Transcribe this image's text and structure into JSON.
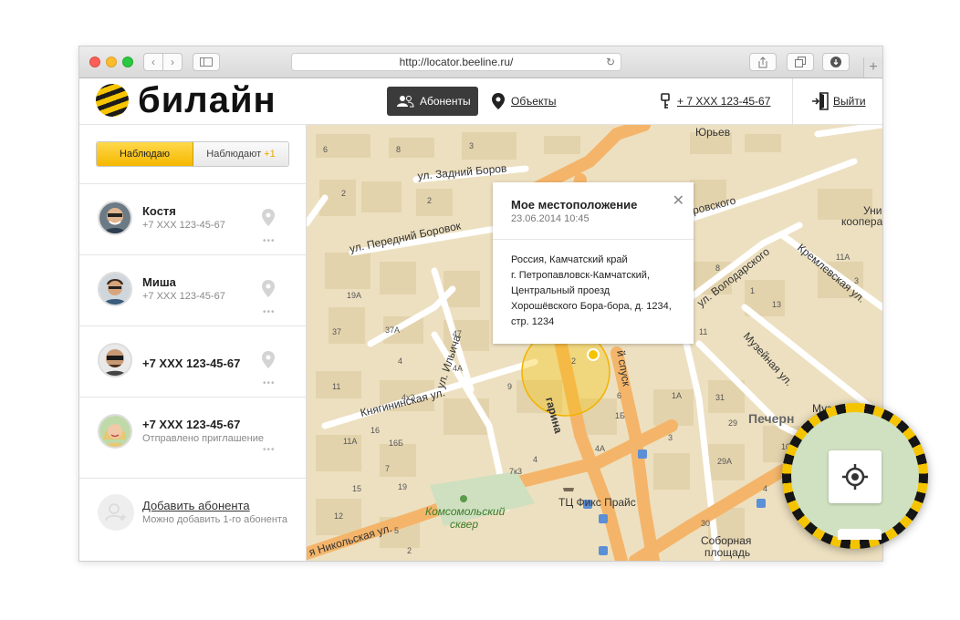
{
  "browser": {
    "url": "http://locator.beeline.ru/"
  },
  "header": {
    "logo_text": "билайн",
    "tab_subscribers": "Абоненты",
    "tab_objects": "Объекты",
    "phone": "+ 7 XXX 123-45-67",
    "logout": "Выйти"
  },
  "sidebar": {
    "toggle_watching": "Наблюдаю",
    "toggle_watched": "Наблюдают",
    "toggle_watched_count": "+1",
    "contacts": [
      {
        "name": "Костя",
        "phone": "+7 XXX 123-45-67"
      },
      {
        "name": "Миша",
        "phone": "+7 XXX 123-45-67"
      },
      {
        "name": "+7 XXX 123-45-67"
      },
      {
        "name": "+7 XXX 123-45-67",
        "status": "Отправлено приглашение"
      }
    ],
    "add_title": "Добавить абонента",
    "add_sub": "Можно добавить 1-го абонента"
  },
  "popup": {
    "title": "Мое местоположение",
    "time": "23.06.2014 10:45",
    "address": [
      "Россия, Камчатский край",
      "г. Петропавловск-Камчатский,",
      "Центральный проезд",
      "Хорошёвского Бора-бора, д. 1234,",
      "стр. 1234"
    ]
  },
  "map": {
    "streets": {
      "zadniy": "ул. Задний Боров",
      "peredniy": "ул. Передний Боровок",
      "ilyicha": "ул. Ильича",
      "knyaginin": "Княгининская ул.",
      "nikolskaya": "я Никольская ул.",
      "gagarina": "гарина",
      "spusk": "й спуск",
      "yurev": "Юрьев",
      "borovsk": "ровского",
      "volodarsk": "ул. Володарского",
      "kreml": "Кремлевская ул.",
      "muzein": "Музейная ул.",
      "pechern": "Печерн",
      "uni": "Уни",
      "koopera": "коопера",
      "muz": "Муз"
    },
    "park": [
      "Комсомольский",
      "сквер"
    ],
    "mall": "ТЦ Фикс Прайс",
    "square": [
      "Соборная",
      "площадь"
    ],
    "house_numbers": [
      "6",
      "8",
      "3",
      "2",
      "2",
      "19A",
      "37",
      "37A",
      "47",
      "4A",
      "4",
      "4x2",
      "11",
      "9",
      "16",
      "16Б",
      "11A",
      "7",
      "19",
      "15",
      "12",
      "7к3",
      "4",
      "4A",
      "1Б",
      "1A",
      "3",
      "31",
      "29",
      "29A",
      "10",
      "4",
      "4",
      "30",
      "2",
      "5",
      "5",
      "11A",
      "3",
      "1",
      "13",
      "8",
      "11",
      "2",
      "6"
    ]
  },
  "colors": {
    "brand_yellow": "#f5c400",
    "brand_black": "#151515",
    "map_bg": "#ede0c0",
    "road_major": "#f4b56a"
  }
}
